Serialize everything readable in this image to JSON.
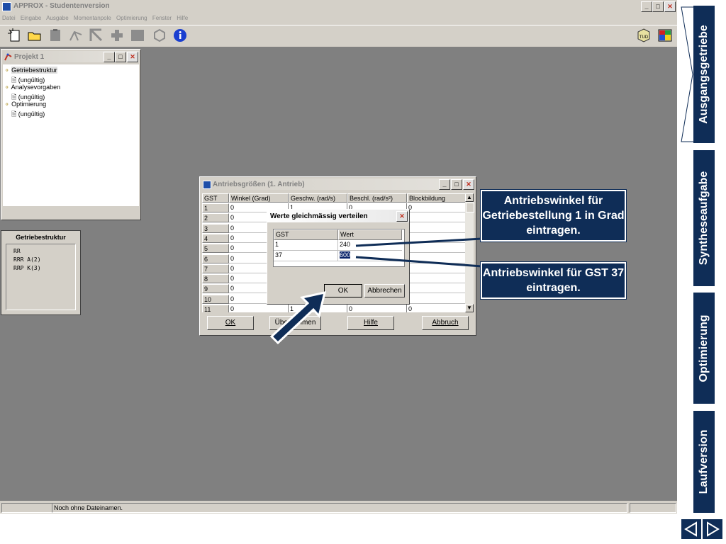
{
  "app": {
    "title": "APPROX - Studentenversion",
    "menu": [
      "Datei",
      "Eingabe",
      "Ausgabe",
      "Momentanpole",
      "Optimierung",
      "Fenster",
      "Hilfe"
    ],
    "window_controls": [
      "_",
      "□",
      "✕"
    ],
    "toolbar_icons": [
      "new-file-icon",
      "open-folder-icon",
      "paste-icon",
      "mechanism-icon",
      "arrow-link-icon",
      "gear-link-icon",
      "square-icon",
      "hexagon-icon",
      "info-icon"
    ],
    "toolbar_right_icons": [
      "optimize-tud-icon",
      "window-tiles-icon"
    ]
  },
  "project": {
    "title": "Projekt 1",
    "tree": [
      {
        "label": "Getriebestruktur",
        "selected": true,
        "children": [
          "(ungültig)"
        ]
      },
      {
        "label": "Analysevorgaben",
        "selected": false,
        "children": [
          "(ungültig)"
        ]
      },
      {
        "label": "Optimierung",
        "selected": false,
        "children": [
          "(ungültig)"
        ]
      }
    ]
  },
  "structure_panel": {
    "title": "Getriebestruktur",
    "lines": [
      "RR",
      "RRR A(2)",
      "RRP K(3)"
    ]
  },
  "drive_window": {
    "title": "Antriebsgrößen (1. Antrieb)",
    "columns": [
      "GST",
      "Winkel (Grad)",
      "Geschw. (rad/s)",
      "Beschl. (rad/s²)",
      "Blockbildung"
    ],
    "rows": [
      [
        "1",
        "0",
        "1",
        "0",
        "0"
      ],
      [
        "2",
        "0",
        "",
        "",
        ""
      ],
      [
        "3",
        "0",
        "",
        "",
        ""
      ],
      [
        "4",
        "0",
        "",
        "",
        ""
      ],
      [
        "5",
        "0",
        "",
        "",
        ""
      ],
      [
        "6",
        "0",
        "",
        "",
        ""
      ],
      [
        "7",
        "0",
        "",
        "",
        ""
      ],
      [
        "8",
        "0",
        "",
        "",
        ""
      ],
      [
        "9",
        "0",
        "",
        "",
        ""
      ],
      [
        "10",
        "0",
        "",
        "",
        ""
      ],
      [
        "11",
        "0",
        "1",
        "0",
        "0"
      ]
    ],
    "buttons": {
      "ok": "OK",
      "apply": "Übernehmen",
      "help": "Hilfe",
      "abort": "Abbruch"
    }
  },
  "distribute_dialog": {
    "title": "Werte gleichmässig verteilen",
    "columns": [
      "GST",
      "Wert"
    ],
    "rows": [
      [
        "1",
        "240"
      ],
      [
        "37",
        "600"
      ]
    ],
    "buttons": {
      "ok": "OK",
      "cancel": "Abbrechen"
    }
  },
  "callouts": {
    "first": "Antriebswinkel für Getriebestellung 1 in Grad eintragen.",
    "second": "Antriebswinkel für GST 37 eintragen."
  },
  "statusbar": {
    "text": "Noch ohne Dateinamen."
  },
  "sidebar": {
    "tabs": [
      "Ausgangsgetriebe",
      "Syntheseaufgabe",
      "Optimierung",
      "Laufversion"
    ],
    "active": "Ausgangsgetriebe",
    "nav": {
      "prev": "◁",
      "next": "▷"
    }
  },
  "colors": {
    "navy": "#0f2d57",
    "mdi": "#808080",
    "face": "#d4d0c8"
  }
}
